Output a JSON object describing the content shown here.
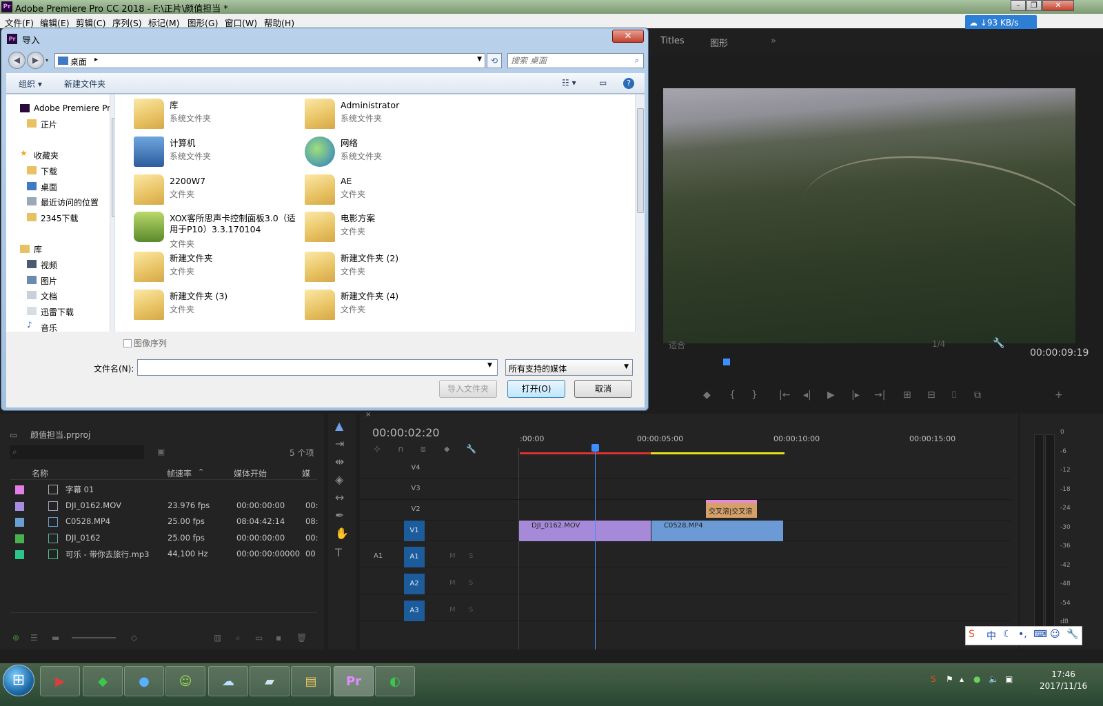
{
  "premiere": {
    "window_title": "Adobe Premiere Pro CC 2018 - F:\\正片\\颜值担当 *",
    "menus": [
      "文件(F)",
      "编辑(E)",
      "剪辑(C)",
      "序列(S)",
      "标记(M)",
      "图形(G)",
      "窗口(W)",
      "帮助(H)"
    ],
    "top_tabs": [
      "Titles",
      "图形"
    ],
    "overflow_tab": "»",
    "speed": "93 KB/s",
    "program": {
      "timecode": "00:00:09:19",
      "fit": "适合",
      "res": "1/4"
    },
    "project": {
      "file": "颜值担当.prproj",
      "count": "5 个项",
      "columns": [
        "名称",
        "帧速率",
        "媒体开始",
        "媒"
      ],
      "items": [
        {
          "color": "#e27ee6",
          "name": "字幕 01",
          "fps": "",
          "start": "",
          "more": ""
        },
        {
          "color": "#a78de0",
          "name": "DJI_0162.MOV",
          "fps": "23.976 fps",
          "start": "00:00:00:00",
          "more": "00:"
        },
        {
          "color": "#6b9fd4",
          "name": "C0528.MP4",
          "fps": "25.00 fps",
          "start": "08:04:42:14",
          "more": "08:"
        },
        {
          "color": "#47b04f",
          "name": "DJI_0162",
          "fps": "25.00 fps",
          "start": "00:00:00:00",
          "more": "00:"
        },
        {
          "color": "#2cc68a",
          "name": "可乐 - 带你去旅行.mp3",
          "fps": "44,100 Hz",
          "start": "00:00:00:00000",
          "more": "00"
        }
      ]
    },
    "timeline": {
      "timecode": "00:00:02:20",
      "ruler": [
        ":00:00",
        "00:00:05:00",
        "00:00:10:00",
        "00:00:15:00"
      ],
      "tracks": [
        "V4",
        "V3",
        "V2",
        "V1",
        "A1",
        "A2",
        "A3"
      ],
      "source_label": "A1",
      "clips": {
        "v1a": "DJI_0162.MOV",
        "v1b": "C0528.MP4",
        "v2": "交叉溶",
        "v2b": "交叉溶"
      },
      "audio_marks": {
        "m": "M",
        "s": "S"
      }
    },
    "meter_db": [
      "0",
      "-6",
      "-12",
      "-18",
      "-24",
      "-30",
      "-36",
      "-42",
      "-48",
      "-54",
      "dB"
    ],
    "ime": {
      "lang": "中"
    }
  },
  "dialog": {
    "title": "导入",
    "address": "桌面",
    "search_placeholder": "搜索 桌面",
    "toolbar": {
      "organize": "组织 ▾",
      "new_folder": "新建文件夹"
    },
    "nav": {
      "top": "Adobe Premiere Pr",
      "zhengpian": "正片",
      "favorites": "收藏夹",
      "download": "下载",
      "desktop": "桌面",
      "recent": "最近访问的位置",
      "d2345": "2345下载",
      "libraries": "库",
      "video": "视频",
      "pictures": "图片",
      "docs": "文档",
      "xunlei": "迅雷下载",
      "music": "音乐"
    },
    "files": [
      {
        "name": "库",
        "type": "系统文件夹"
      },
      {
        "name": "Administrator",
        "type": "系统文件夹"
      },
      {
        "name": "计算机",
        "type": "系统文件夹"
      },
      {
        "name": "网络",
        "type": "系统文件夹"
      },
      {
        "name": "2200W7",
        "type": "文件夹"
      },
      {
        "name": "AE",
        "type": "文件夹"
      },
      {
        "name": "XOX客所思声卡控制面板3.0（适用于P10）3.3.170104",
        "type": "文件夹"
      },
      {
        "name": "电影方案",
        "type": "文件夹"
      },
      {
        "name": "新建文件夹",
        "type": "文件夹"
      },
      {
        "name": "新建文件夹 (2)",
        "type": "文件夹"
      },
      {
        "name": "新建文件夹 (3)",
        "type": "文件夹"
      },
      {
        "name": "新建文件夹 (4)",
        "type": "文件夹"
      }
    ],
    "image_sequence": "图像序列",
    "filename_label": "文件名(N):",
    "filename_value": "",
    "filetype": "所有支持的媒体",
    "buttons": {
      "import_folder": "导入文件夹",
      "open": "打开(O)",
      "cancel": "取消"
    }
  },
  "taskbar": {
    "time": "17:46",
    "date": "2017/11/16"
  }
}
